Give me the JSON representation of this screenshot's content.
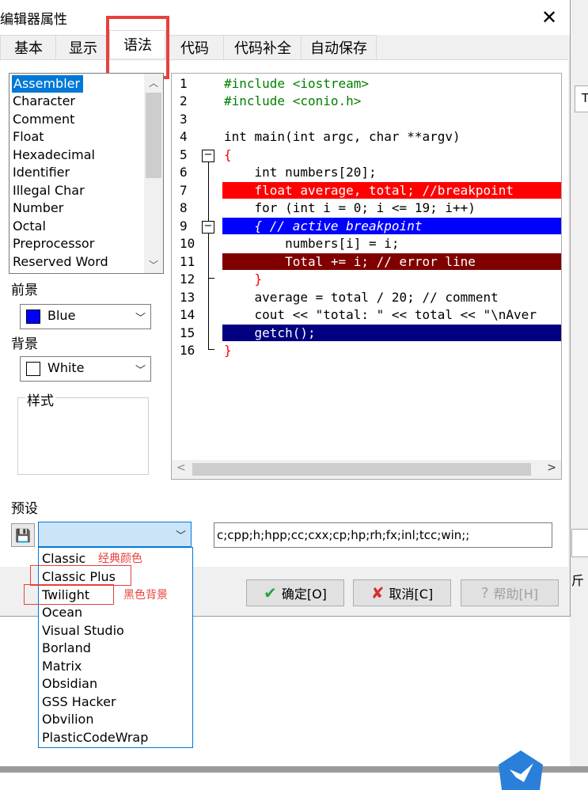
{
  "window": {
    "title": "编辑器属性",
    "close": "✕"
  },
  "tabs": [
    {
      "label": "基本"
    },
    {
      "label": "显示"
    },
    {
      "label": "语法"
    },
    {
      "label": "代码"
    },
    {
      "label": "代码补全"
    },
    {
      "label": "自动保存"
    }
  ],
  "token_list": {
    "items": [
      "Assembler",
      "Character",
      "Comment",
      "Float",
      "Hexadecimal",
      "Identifier",
      "Illegal Char",
      "Number",
      "Octal",
      "Preprocessor",
      "Reserved Word"
    ],
    "selected": "Assembler"
  },
  "foreground": {
    "label": "前景",
    "value": "Blue",
    "color": "#0000ff"
  },
  "background": {
    "label": "背景",
    "value": "White",
    "color": "#ffffff"
  },
  "style_group": {
    "label": "样式"
  },
  "code": {
    "line_numbers": [
      "1",
      "2",
      "3",
      "4",
      "5",
      "6",
      "7",
      "8",
      "9",
      "10",
      "11",
      "12",
      "13",
      "14",
      "15",
      "16"
    ],
    "lines": [
      "#include <iostream>",
      "#include <conio.h>",
      "",
      "int main(int argc, char **argv)",
      "{",
      "    int numbers[20];",
      "    float average, total; //breakpoint",
      "    for (int i = 0; i <= 19; i++)",
      "    { // active breakpoint",
      "        numbers[i] = i;",
      "        Total += i; // error line",
      "    }",
      "    average = total / 20; // comment",
      "    cout << \"total: \" << total << \"\\nAver",
      "    getch();",
      "}"
    ],
    "colors": {
      "breakpoint": "#ff0000",
      "active_breakpoint": "#0000ff",
      "error_line": "#800000",
      "selected_line": "#000080",
      "preprocessor": "#008000",
      "number": "#800080",
      "string": "#0000ff",
      "symbol": "#ff0000"
    }
  },
  "presets": {
    "label": "预设",
    "selected": "",
    "extensions": "c;cpp;h;hpp;cc;cxx;cp;hp;rh;fx;inl;tcc;win;;",
    "options": [
      "Classic",
      "Classic Plus",
      "Twilight",
      "Ocean",
      "Visual Studio",
      "Borland",
      "Matrix",
      "Obsidian",
      "GSS Hacker",
      "Obvilion",
      "PlasticCodeWrap"
    ],
    "annotations": {
      "classic": "经典颜色",
      "twilight": "黑色背景"
    }
  },
  "buttons": {
    "ok": "确定[O]",
    "ok_icon": "check-icon",
    "cancel": "取消[C]",
    "cancel_icon": "x-icon",
    "help": "帮助[H]",
    "help_icon": "question-icon"
  },
  "background_app": {
    "side_label": "T",
    "side_label2": "斤"
  }
}
